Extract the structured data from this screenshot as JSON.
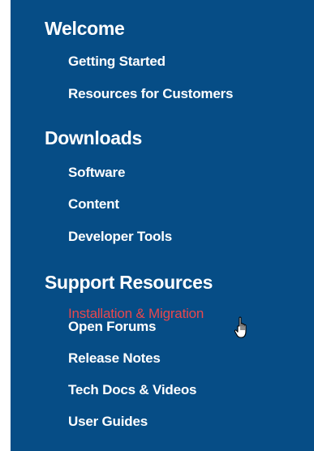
{
  "accent_color": "#064d86",
  "active_link_color": "#e8474d",
  "sections": [
    {
      "heading": "Welcome",
      "links": [
        "Getting Started",
        "Resources for Customers"
      ]
    },
    {
      "heading": "Downloads",
      "links": [
        "Software",
        "Content",
        "Developer Tools"
      ]
    },
    {
      "heading": "Support Resources",
      "links": [
        "Installation & Migration",
        "Open Forums",
        "Release Notes",
        "Tech Docs & Videos",
        "User Guides"
      ]
    }
  ],
  "active_link": "Installation & Migration",
  "cursor_icon": "hand-pointer-icon"
}
